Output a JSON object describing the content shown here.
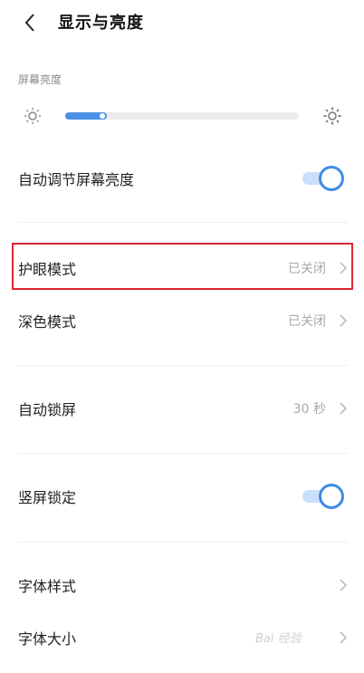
{
  "header": {
    "title": "显示与亮度"
  },
  "brightness": {
    "section_title": "屏幕亮度",
    "level": 0.18
  },
  "settings": [
    {
      "label": "自动调节屏幕亮度",
      "toggle": true
    },
    {
      "label": "护眼模式",
      "value": "已关闭"
    },
    {
      "label": "深色模式",
      "value": "已关闭"
    },
    {
      "label": "自动锁屏",
      "value": "30 秒"
    },
    {
      "label": "竖屏锁定",
      "toggle": true
    },
    {
      "label": "字体样式"
    },
    {
      "label": "字体大小"
    }
  ],
  "colors": {
    "accent": "#3f8be8",
    "highlight": "#e0262f"
  },
  "watermark": "Bai 经验"
}
